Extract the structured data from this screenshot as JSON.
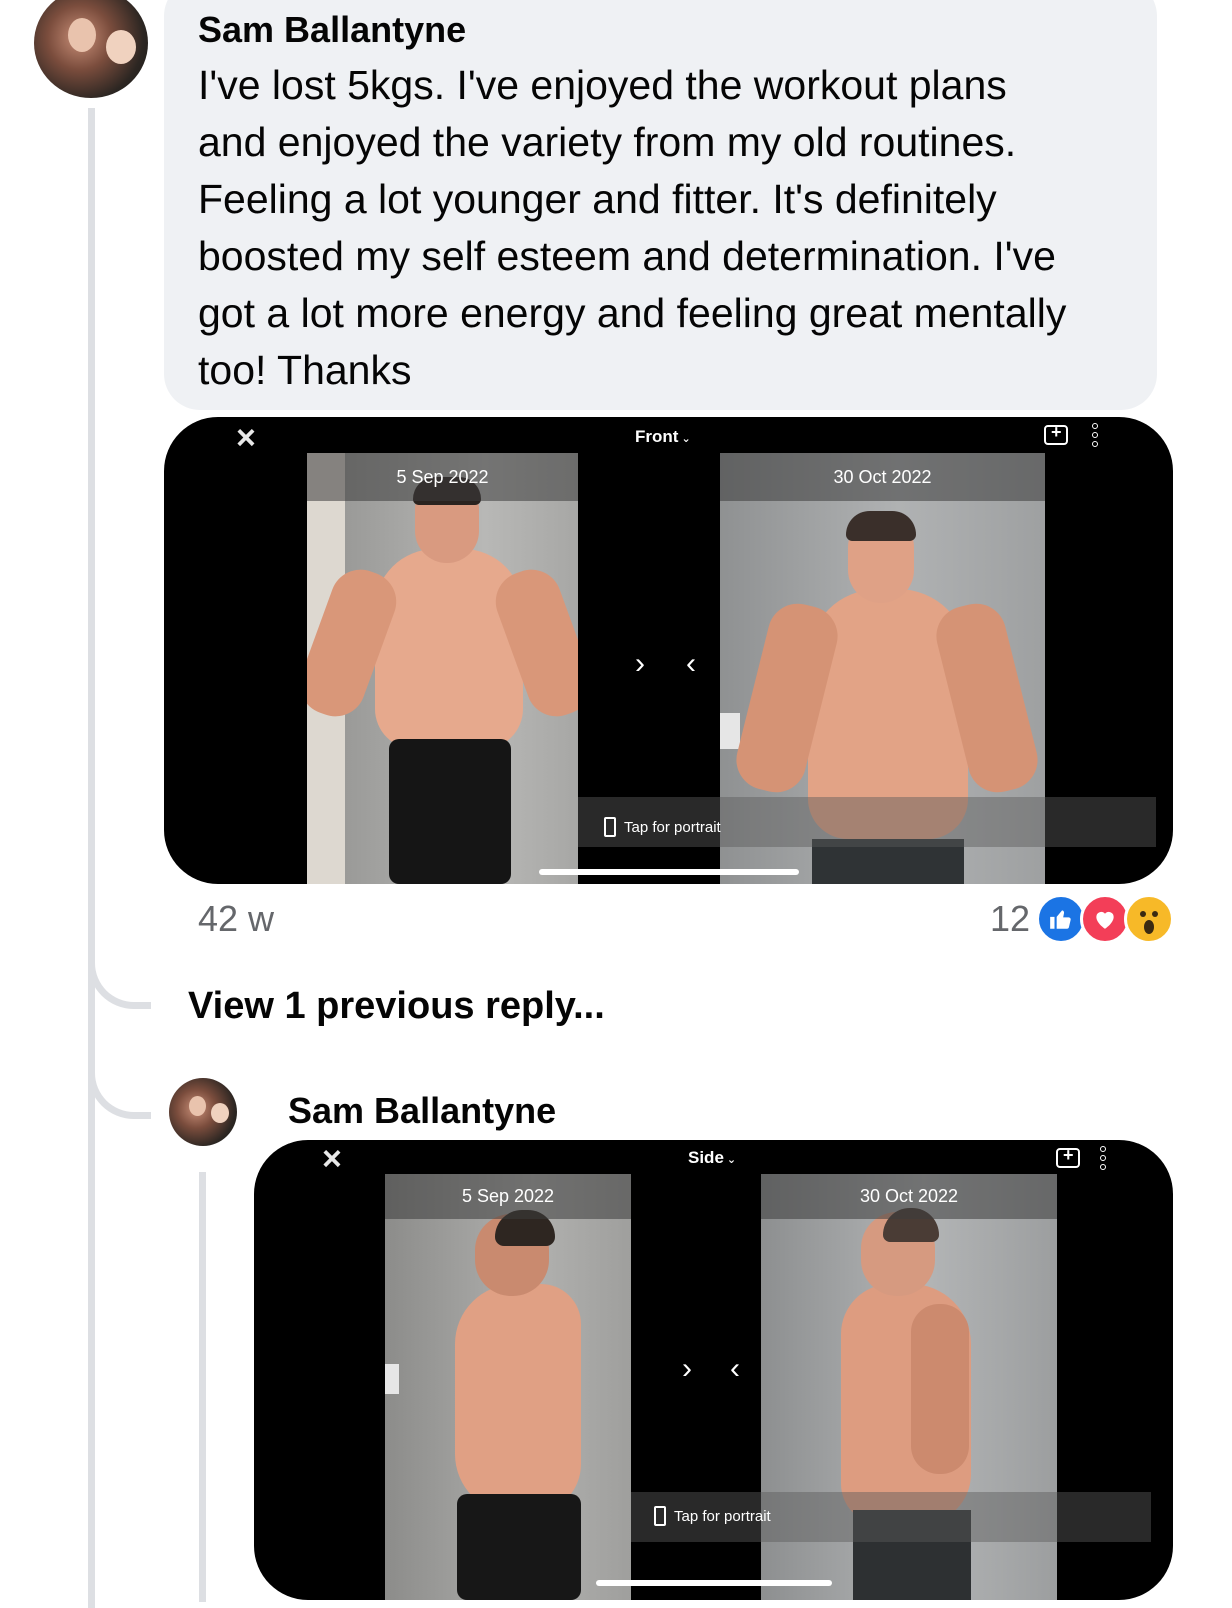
{
  "comment": {
    "author": "Sam Ballantyne",
    "text": "I've lost 5kgs. I've enjoyed the workout plans\nand enjoyed the variety from my old routines.\nFeeling a lot younger and fitter. It's definitely\nboosted my self esteem and determination. I've\ngot a lot more energy and feeling great mentally\ntoo! Thanks",
    "timestamp": "42 w",
    "reaction_count": "12",
    "reactions": [
      "like-icon",
      "love-icon",
      "wow-icon"
    ]
  },
  "front_card": {
    "view_label": "Front",
    "before_date": "5 Sep 2022",
    "after_date": "30 Oct 2022",
    "next_arrow": "›",
    "prev_arrow": "‹",
    "tap_label": "Tap for portrait"
  },
  "view_previous": "View 1 previous reply...",
  "reply": {
    "author": "Sam Ballantyne"
  },
  "side_card": {
    "view_label": "Side",
    "before_date": "5 Sep 2022",
    "after_date": "30 Oct 2022",
    "next_arrow": "›",
    "prev_arrow": "‹",
    "tap_label": "Tap for portrait"
  },
  "colors": {
    "bubble": "#eff1f4",
    "meta_text": "#65676b",
    "like": "#1b74e4",
    "love": "#f33e58",
    "wow": "#f7b928"
  }
}
